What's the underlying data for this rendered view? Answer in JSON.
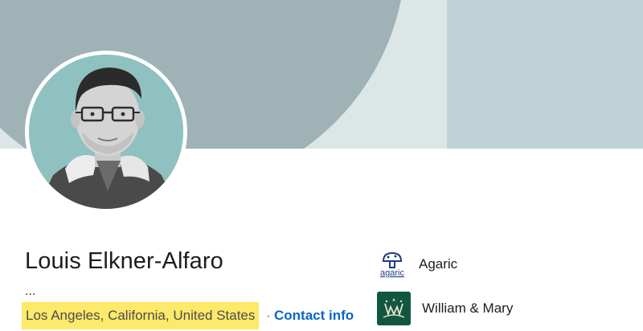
{
  "profile": {
    "name": "Louis Elkner-Alfaro",
    "headline": "...",
    "location": "Los Angeles, California, United States",
    "separator": "·",
    "contact_label": "Contact info"
  },
  "organizations": [
    {
      "name": "Agaric",
      "logo_text": "agaric",
      "icon": "agaric-logo"
    },
    {
      "name": "William & Mary",
      "icon": "william-and-mary-logo"
    }
  ],
  "colors": {
    "banner_dark": "#9fb2b6",
    "banner_light": "#dde6e7",
    "banner_right": "#bfd2d8",
    "highlight": "#fde96a",
    "link": "#0a66c2",
    "wm_green": "#115740"
  }
}
